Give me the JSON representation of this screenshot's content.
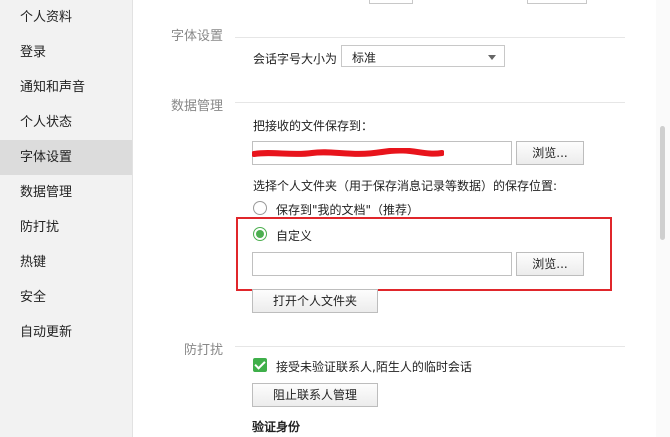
{
  "sidebar": {
    "items": [
      {
        "label": "个人资料"
      },
      {
        "label": "登录"
      },
      {
        "label": "通知和声音"
      },
      {
        "label": "个人状态"
      },
      {
        "label": "字体设置",
        "active": true
      },
      {
        "label": "数据管理"
      },
      {
        "label": "防打扰"
      },
      {
        "label": "热键"
      },
      {
        "label": "安全"
      },
      {
        "label": "自动更新"
      }
    ]
  },
  "font_section": {
    "title": "字体设置",
    "size_label": "会话字号大小为",
    "size_value": "标准"
  },
  "data_section": {
    "title": "数据管理",
    "save_files_label": "把接收的文件保存到：",
    "browse_label_1": "浏览...",
    "folder_desc": "选择个人文件夹（用于保存消息记录等数据）的保存位置:",
    "option_mydocs": "保存到\"我的文档\"（推荐）",
    "option_custom": "自定义",
    "custom_path": "",
    "browse_label_2": "浏览...",
    "open_folder_label": "打开个人文件夹"
  },
  "dnd_section": {
    "title": "防打扰",
    "accept_label": "接受未验证联系人,陌生人的临时会话",
    "block_button": "阻止联系人管理",
    "verify_heading": "验证身份"
  },
  "colors": {
    "accent": "#4caf50",
    "highlight": "#e0262b",
    "redaction": "#e8141c"
  }
}
